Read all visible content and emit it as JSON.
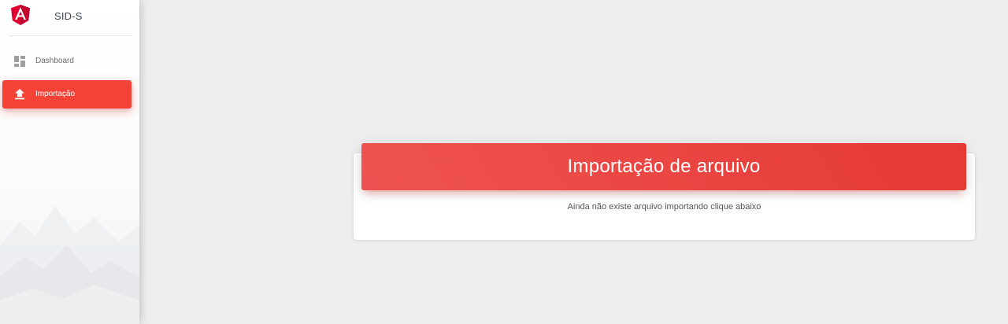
{
  "app": {
    "name": "SID-S",
    "logo_icon": "angular-logo-icon",
    "brand_color": "#dd0031"
  },
  "sidebar": {
    "items": [
      {
        "label": "Dashboard",
        "icon": "dashboard-icon",
        "active": false
      },
      {
        "label": "Importação",
        "icon": "upload-icon",
        "active": true
      }
    ],
    "active_color": "#f44336"
  },
  "main": {
    "card": {
      "title": "Importação de arquivo",
      "message": "Ainda não existe arquivo importando clique abaixo",
      "header_color": "#e53935"
    }
  }
}
